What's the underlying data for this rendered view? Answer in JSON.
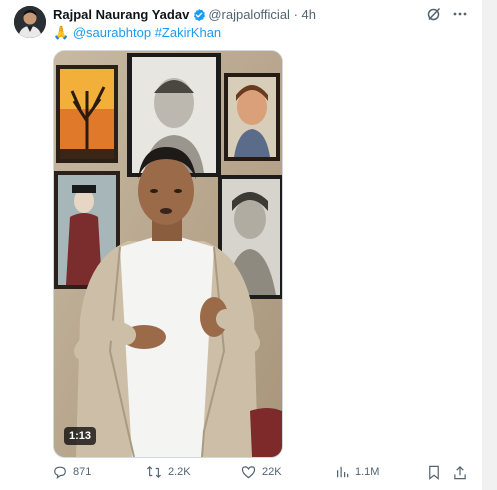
{
  "author": {
    "name": "Rajpal Naurang Yadav",
    "handle": "@rajpalofficial",
    "separator": "·",
    "time": "4h"
  },
  "tweet": {
    "emoji": "🙏",
    "mention": "@saurabhtop",
    "hashtag": "#ZakirKhan"
  },
  "media": {
    "duration": "1:13"
  },
  "actions": {
    "replies": "871",
    "reposts": "2.2K",
    "likes": "22K",
    "views": "1.1M"
  },
  "colors": {
    "accent": "#1d9bf0",
    "text": "#0f1419",
    "muted": "#536471"
  },
  "icons": [
    "verified-badge-icon",
    "grok-icon",
    "more-icon",
    "reply-icon",
    "repost-icon",
    "like-icon",
    "views-icon",
    "bookmark-icon",
    "share-icon"
  ]
}
